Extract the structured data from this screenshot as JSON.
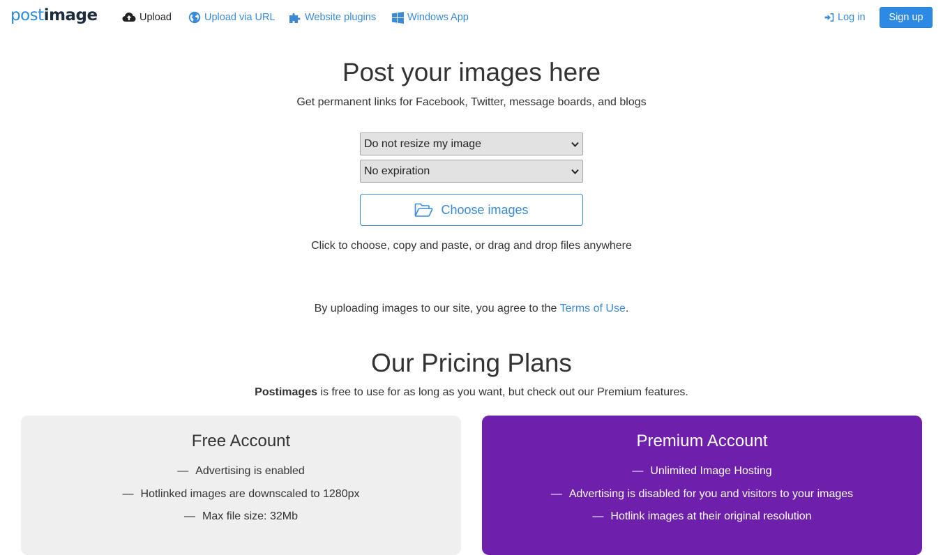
{
  "brand": {
    "logo_post": "post",
    "logo_image": "image"
  },
  "nav": {
    "upload": "Upload",
    "upload_url": "Upload via URL",
    "plugins": "Website plugins",
    "windows_app": "Windows App",
    "login": "Log in",
    "signup": "Sign up"
  },
  "hero": {
    "title": "Post your images here",
    "subtitle": "Get permanent links for Facebook, Twitter, message boards, and blogs",
    "resize_select": "Do not resize my image",
    "expire_select": "No expiration",
    "choose_button": "Choose images",
    "hint": "Click to choose, copy and paste, or drag and drop files anywhere",
    "terms_prefix": "By uploading images to our site, you agree to the ",
    "terms_link": "Terms of Use",
    "terms_suffix": "."
  },
  "pricing": {
    "title": "Our Pricing Plans",
    "subtitle_brand": "Postimages",
    "subtitle_rest": " is free to use for as long as you want, but check out our Premium features.",
    "free": {
      "title": "Free Account",
      "features": [
        "Advertising is enabled",
        "Hotlinked images are downscaled to 1280px",
        "Max file size: 32Mb"
      ]
    },
    "premium": {
      "title": "Premium Account",
      "features": [
        "Unlimited Image Hosting",
        "Advertising is disabled for you and visitors to your images",
        "Hotlink images at their original resolution"
      ]
    }
  },
  "colors": {
    "link": "#3a8ad6",
    "signup_bg": "#2c8ae4",
    "free_card_bg": "#efefef",
    "premium_card_bg": "#6e1fac"
  },
  "icons": {
    "upload": "cloud-upload-icon",
    "url": "globe-icon",
    "plugins": "puzzle-icon",
    "windows": "windows-icon",
    "login": "sign-in-icon",
    "choose": "folder-open-icon",
    "select": "chevron-down-icon"
  }
}
